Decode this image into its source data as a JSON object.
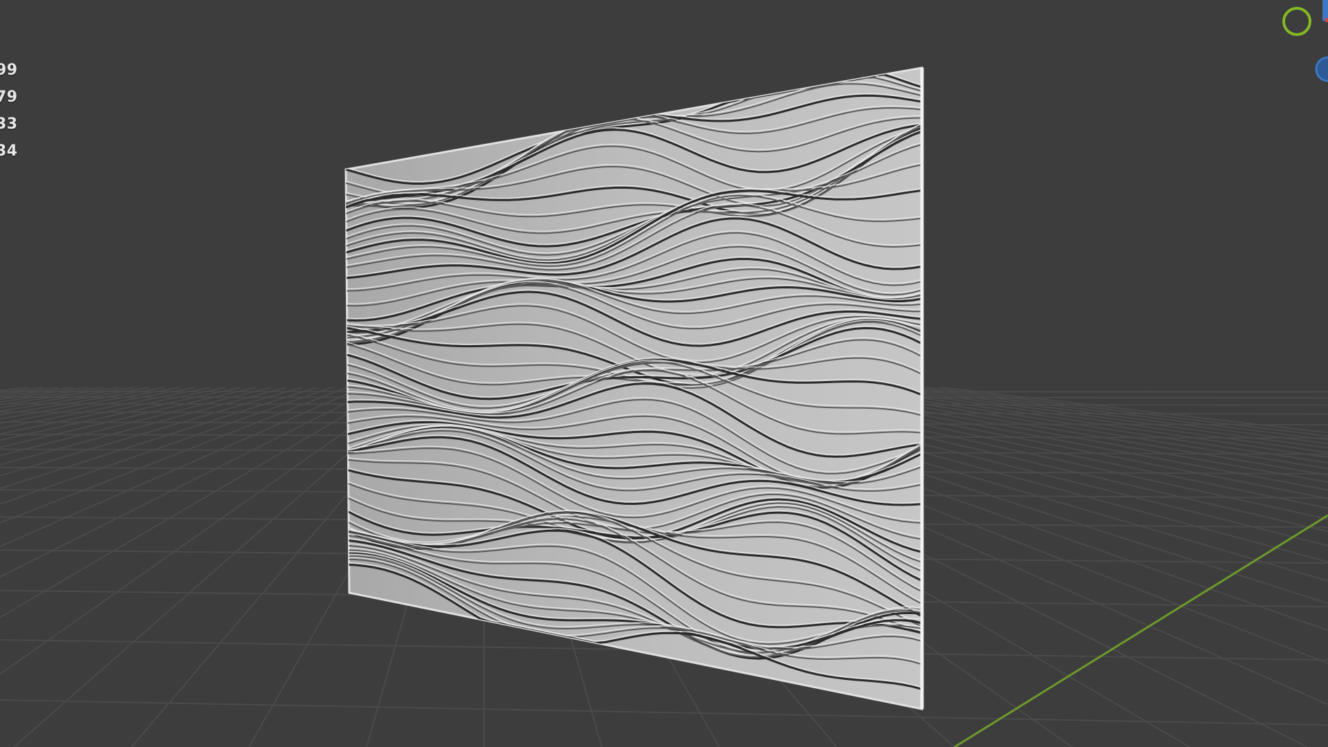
{
  "viewport": {
    "background": "#3d3d3d",
    "grid_color": "#4a4a4a",
    "axis_y_color": "#6e9a2c",
    "panel_color": "#b5b5b5"
  },
  "overlay": {
    "stats": [
      "99",
      "79",
      "33",
      "34"
    ]
  },
  "gizmo": {
    "axes": [
      {
        "name": "x-axis-icon",
        "color": "#c84a4a"
      },
      {
        "name": "y-axis-icon",
        "color": "#86b824"
      },
      {
        "name": "z-axis-icon",
        "color": "#3d78c4"
      }
    ]
  }
}
